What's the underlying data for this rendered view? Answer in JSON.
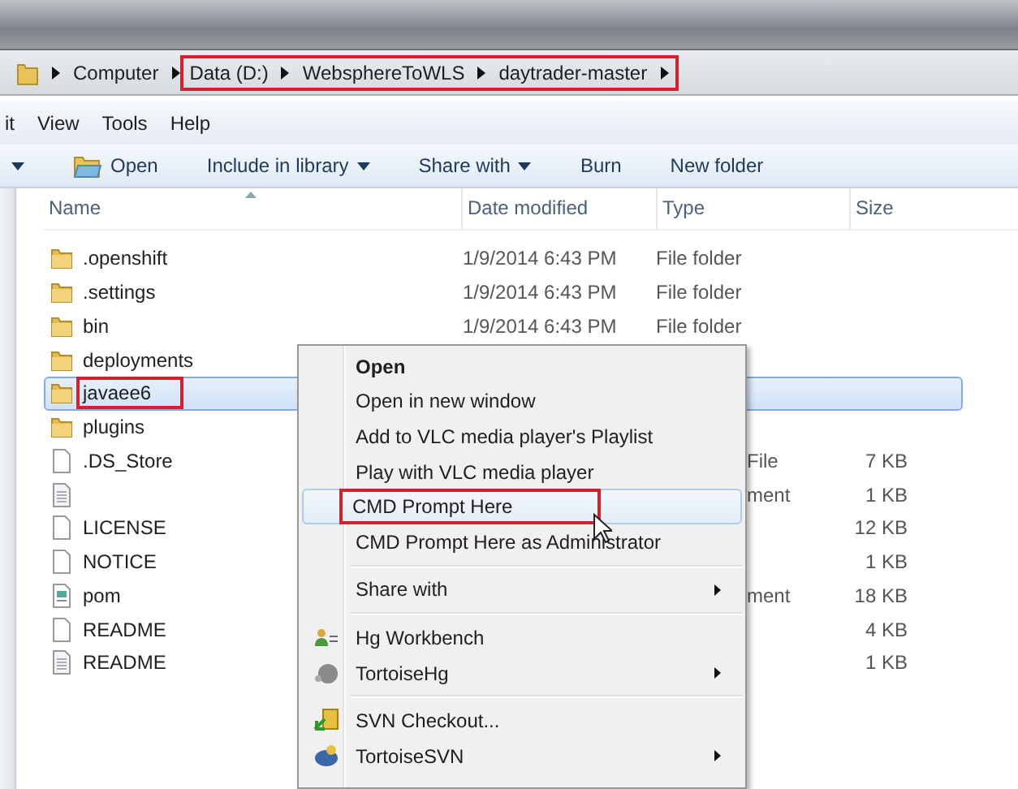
{
  "address_bar": {
    "crumbs": [
      {
        "label": "Computer",
        "annotated": false
      },
      {
        "label": "Data (D:)",
        "annotated": true
      },
      {
        "label": "WebsphereToWLS",
        "annotated": true
      },
      {
        "label": "daytrader-master",
        "annotated": true
      }
    ]
  },
  "menu_bar": [
    "it",
    "View",
    "Tools",
    "Help"
  ],
  "toolbar": [
    {
      "kind": "caret"
    },
    {
      "kind": "open",
      "label": "Open"
    },
    {
      "kind": "dropdown",
      "label": "Include in library"
    },
    {
      "kind": "dropdown",
      "label": "Share with"
    },
    {
      "kind": "plain",
      "label": "Burn"
    },
    {
      "kind": "plain",
      "label": "New folder"
    }
  ],
  "columns": [
    "Name",
    "Date modified",
    "Type",
    "Size"
  ],
  "rows": [
    {
      "name": ".openshift",
      "kind": "folder",
      "date": "1/9/2014 6:43 PM",
      "type": "File folder",
      "selected": false,
      "annotated": false
    },
    {
      "name": ".settings",
      "kind": "folder",
      "date": "1/9/2014 6:43 PM",
      "type": "File folder",
      "selected": false,
      "annotated": false
    },
    {
      "name": "bin",
      "kind": "folder",
      "date": "1/9/2014 6:43 PM",
      "type": "File folder",
      "selected": false,
      "annotated": false
    },
    {
      "name": "deployments",
      "kind": "folder",
      "selected": false,
      "annotated": false
    },
    {
      "name": "javaee6",
      "kind": "folder",
      "selected": true,
      "annotated": true
    },
    {
      "name": "plugins",
      "kind": "folder",
      "selected": false,
      "annotated": false
    },
    {
      "name": ".DS_Store",
      "kind": "file",
      "type": "File",
      "size": "7 KB",
      "selected": false,
      "annotated": false
    },
    {
      "kind": "text",
      "type": "ment",
      "size": "1 KB",
      "selected": false,
      "annotated": false
    },
    {
      "name": "LICENSE",
      "kind": "file",
      "size": "12 KB",
      "selected": false,
      "annotated": false
    },
    {
      "name": "NOTICE",
      "kind": "file",
      "size": "1 KB",
      "selected": false,
      "annotated": false
    },
    {
      "name": "pom",
      "kind": "xml",
      "type": "ment",
      "size": "18 KB",
      "selected": false,
      "annotated": false
    },
    {
      "name": "README",
      "kind": "file",
      "size": "4 KB",
      "selected": false,
      "annotated": false
    },
    {
      "name": "README",
      "kind": "text",
      "size": "1 KB",
      "selected": false,
      "annotated": false
    }
  ],
  "context_menu": [
    {
      "kind": "plain",
      "label": "Open",
      "default": true,
      "hovered": false,
      "annotated": false,
      "submenu": false
    },
    {
      "kind": "plain",
      "label": "Open in new window",
      "default": false,
      "hovered": false,
      "annotated": false,
      "submenu": false
    },
    {
      "kind": "plain",
      "label": "Add to VLC media player's Playlist",
      "default": false,
      "hovered": false,
      "annotated": false,
      "submenu": false
    },
    {
      "kind": "plain",
      "label": "Play with VLC media player",
      "default": false,
      "hovered": false,
      "annotated": false,
      "submenu": false
    },
    {
      "kind": "plain",
      "label": "CMD Prompt Here",
      "default": false,
      "hovered": true,
      "annotated": true,
      "submenu": false
    },
    {
      "kind": "plain",
      "label": "CMD Prompt Here as Administrator",
      "default": false,
      "hovered": false,
      "annotated": false,
      "submenu": false
    },
    {
      "kind": "separator"
    },
    {
      "kind": "plain",
      "label": "Share with",
      "default": false,
      "hovered": false,
      "annotated": false,
      "submenu": true
    },
    {
      "kind": "separator"
    },
    {
      "kind": "person",
      "label": "Hg Workbench",
      "default": false,
      "hovered": false,
      "annotated": false,
      "submenu": false
    },
    {
      "kind": "tortoise-gray",
      "label": "TortoiseHg",
      "default": false,
      "hovered": false,
      "annotated": false,
      "submenu": true
    },
    {
      "kind": "separator"
    },
    {
      "kind": "checkout",
      "label": "SVN Checkout...",
      "default": false,
      "hovered": false,
      "annotated": false,
      "submenu": false
    },
    {
      "kind": "tortoise-blue",
      "label": "TortoiseSVN",
      "default": false,
      "hovered": false,
      "annotated": false,
      "submenu": true
    }
  ]
}
